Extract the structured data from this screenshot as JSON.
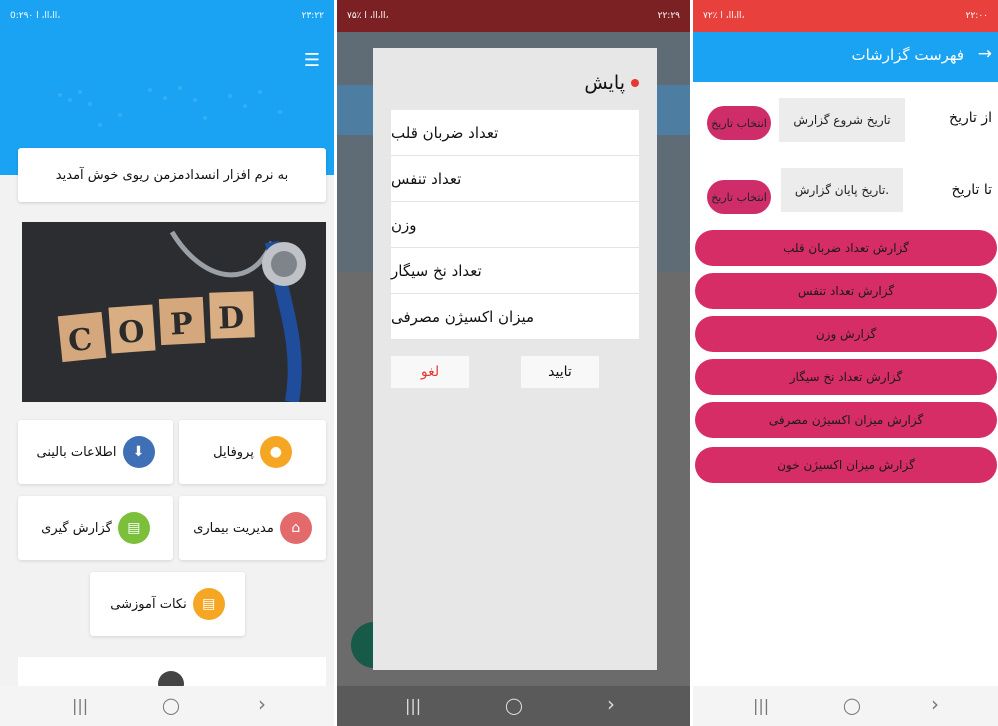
{
  "colors": {
    "primary_blue": "#1aa3f2",
    "pink_button": "#d72d66",
    "red_dot": "#e53935"
  },
  "phone1": {
    "status_left": "0:۲۹۰ اا،اا، ا،",
    "status_right": "۲۳:۲۲",
    "menu_icon": "hamburger-icon",
    "welcome_text": "به نرم افزار انسدادمزمن ریوی خوش آمدید",
    "image_blocks": [
      "C",
      "O",
      "P",
      "D"
    ],
    "tiles": [
      {
        "label": "پروفایل",
        "icon": "person-icon",
        "color": "#f5a623"
      },
      {
        "label": "اطلاعات بالینی",
        "icon": "download-icon",
        "color": "#3f6fb5"
      },
      {
        "label": "مدیریت بیماری",
        "icon": "basket-icon",
        "color": "#e36a6a"
      },
      {
        "label": "گزارش گیری",
        "icon": "document-icon",
        "color": "#7cbf3a"
      },
      {
        "label": "نکات آموزشی",
        "icon": "note-icon",
        "color": "#f5a623"
      }
    ],
    "nav": {
      "recent": "|||",
      "home": "◯",
      "back": "‹"
    }
  },
  "phone2": {
    "status_left": "۷۵٪ اا،اا، ا،",
    "status_right": "۲۲:۲۹",
    "dialog_title": "پایش",
    "items": [
      "تعداد ضربان قلب",
      "تعداد تنفس",
      "وزن",
      "تعداد نخ سیگار",
      "میزان اکسیژن مصرفی"
    ],
    "confirm_label": "تایید",
    "cancel_label": "لغو",
    "nav": {
      "recent": "|||",
      "home": "◯",
      "back": "‹"
    }
  },
  "phone3": {
    "status_left": "۷۲٪ اا،اا، ا،",
    "status_right": "۲۲:۰۰",
    "title": "فهرست گزارشات",
    "from_label": "از تاریخ",
    "to_label": "تا تاریخ",
    "start_date_placeholder": "تاریخ شروع گزارش",
    "end_date_placeholder": ".تاریخ پایان گزارش",
    "pick_date_label": "انتخاب تاریخ",
    "reports": [
      "گزارش تعداد ضربان قلب",
      "گزارش تعداد تنفس",
      "گزارش وزن",
      "گزارش تعداد نخ سیگار",
      "گزارش میزان اکسیژن مصرفی",
      "گزارش میزان اکسیژن خون"
    ],
    "nav": {
      "recent": "|||",
      "home": "◯",
      "back": "‹"
    }
  }
}
